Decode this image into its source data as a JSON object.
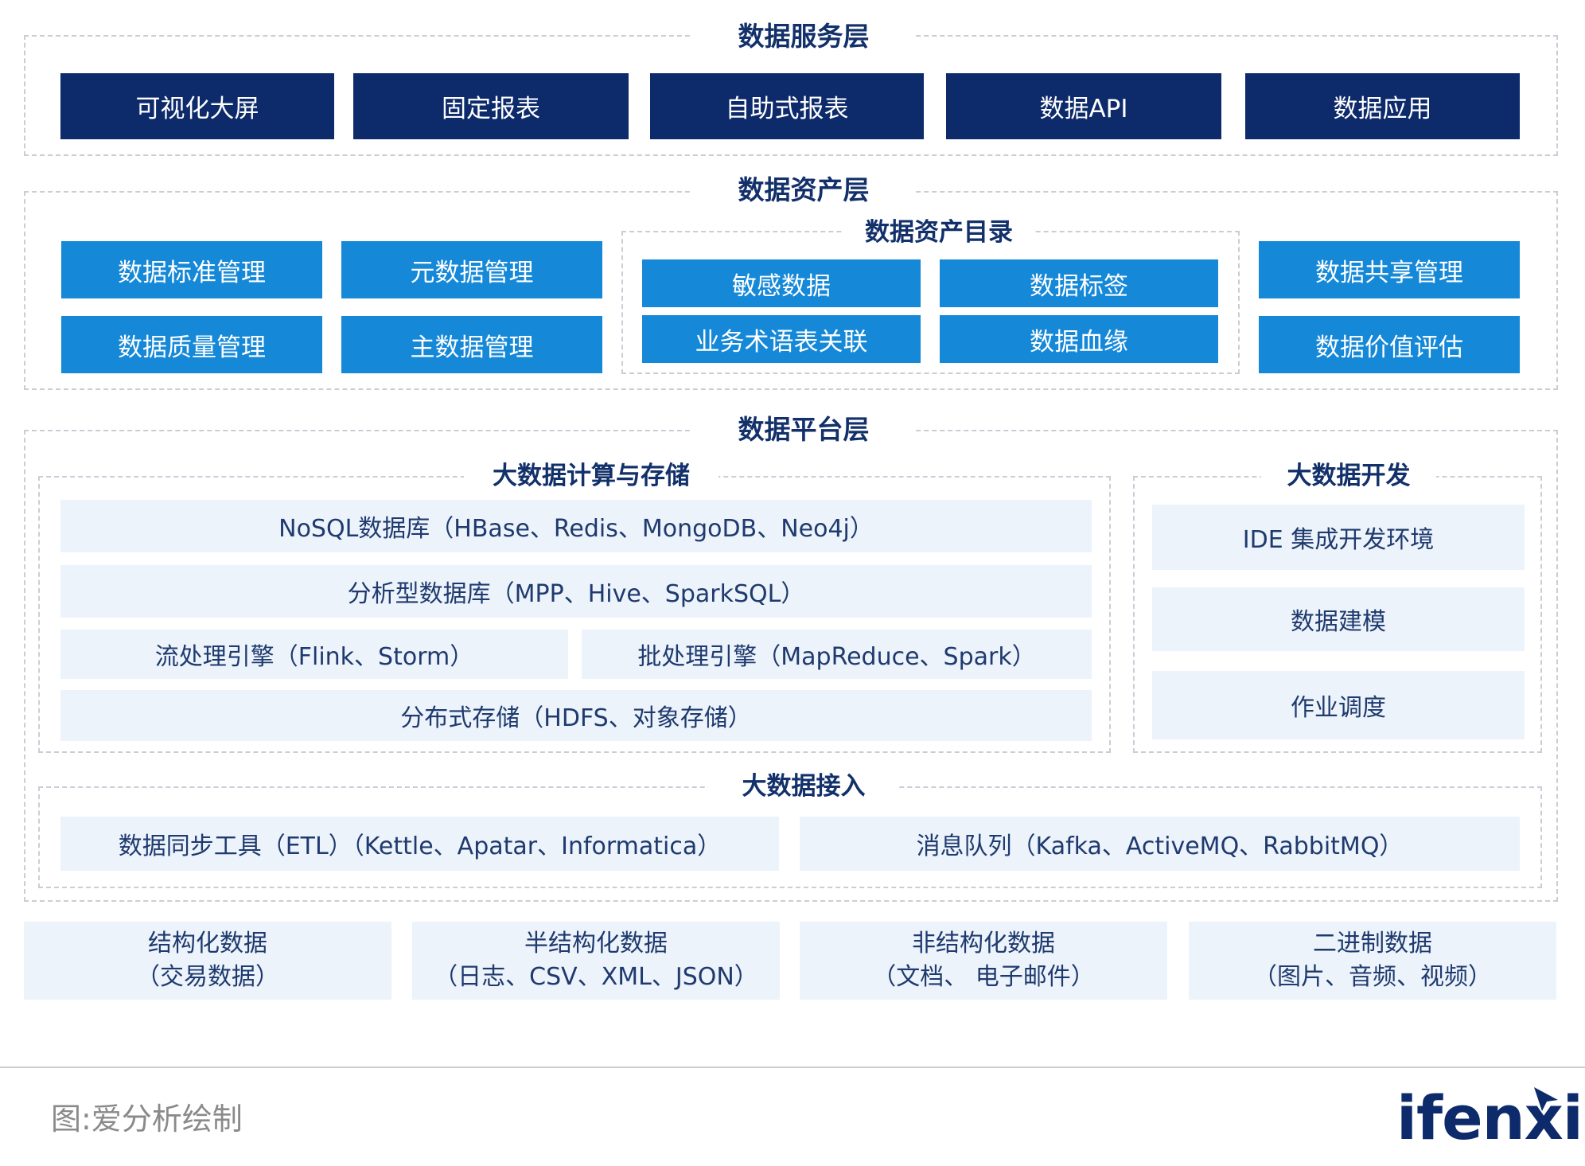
{
  "service_layer": {
    "title": "数据服务层",
    "items": [
      "可视化大屏",
      "固定报表",
      "自助式报表",
      "数据API",
      "数据应用"
    ]
  },
  "asset_layer": {
    "title": "数据资产层",
    "left_items": [
      "数据标准管理",
      "元数据管理",
      "数据质量管理",
      "主数据管理"
    ],
    "catalog": {
      "title": "数据资产目录",
      "items": [
        "敏感数据",
        "数据标签",
        "业务术语表关联",
        "数据血缘"
      ]
    },
    "right_items": [
      "数据共享管理",
      "数据价值评估"
    ]
  },
  "platform_layer": {
    "title": "数据平台层",
    "compute": {
      "title": "大数据计算与存储",
      "nosql": "NoSQL数据库（HBase、Redis、MongoDB、Neo4j）",
      "analytic": "分析型数据库（MPP、Hive、SparkSQL）",
      "stream": "流处理引擎（Flink、Storm）",
      "batch": "批处理引擎（MapReduce、Spark）",
      "storage": "分布式存储（HDFS、对象存储）"
    },
    "dev": {
      "title": "大数据开发",
      "items": [
        "IDE 集成开发环境",
        "数据建模",
        "作业调度"
      ]
    },
    "ingest": {
      "title": "大数据接入",
      "etl": "数据同步工具（ETL）（Kettle、Apatar、Informatica）",
      "mq": "消息队列（Kafka、ActiveMQ、RabbitMQ）"
    }
  },
  "sources": [
    {
      "name": "结构化数据",
      "detail": "（交易数据）"
    },
    {
      "name": "半结构化数据",
      "detail": "（日志、CSV、XML、JSON）"
    },
    {
      "name": "非结构化数据",
      "detail": "（文档、 电子邮件）"
    },
    {
      "name": "二进制数据",
      "detail": "（图片、音频、视频）"
    }
  ],
  "footer": {
    "caption": "图:爱分析绘制",
    "logo_text": "ifenxi"
  },
  "colors": {
    "dark_navy": "#0d2a6b",
    "bright_blue": "#1588d8",
    "light_blue": "#edf3fb",
    "title_navy": "#12306a"
  }
}
